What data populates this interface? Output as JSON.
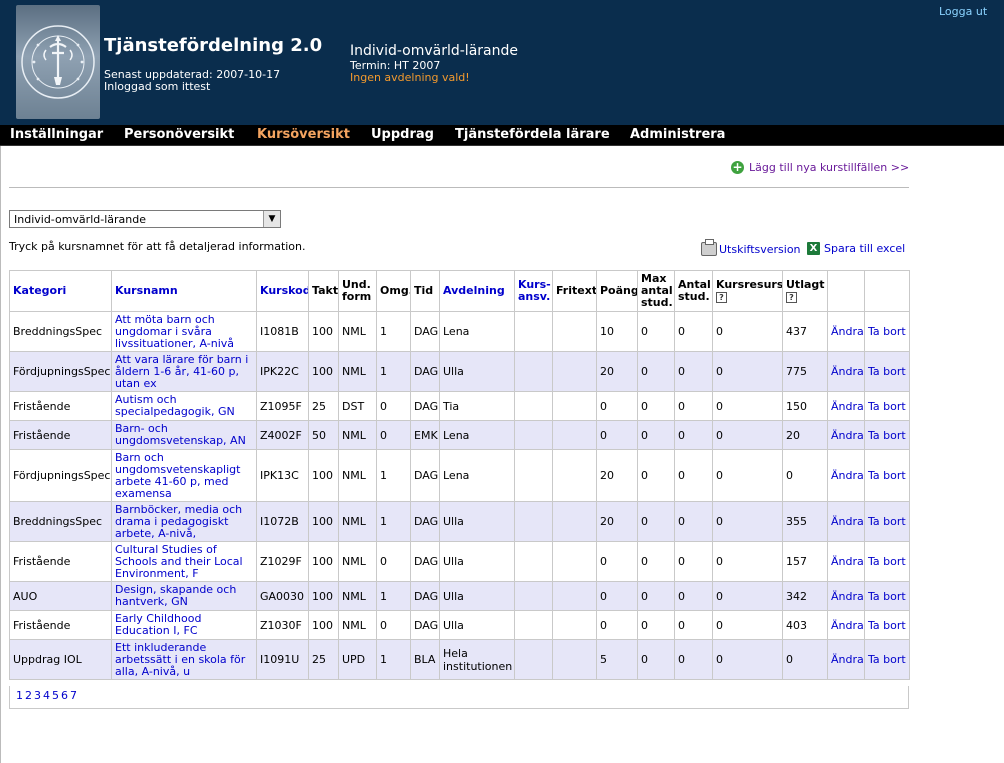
{
  "header": {
    "app_title": "Tjänstefördelning 2.0",
    "updated": "Senast uppdaterad: 2007-10-17",
    "logged_in": "Inloggad som ittest",
    "department": "Individ-omvärld-lärande",
    "term": "Termin: HT 2007",
    "warning": "Ingen avdelning vald!",
    "logout": "Logga ut",
    "logo_icon": "stockholm-university-seal-icon",
    "logo_lettering": "UNIVERSITET STOCKHOLMS"
  },
  "nav": {
    "items": [
      {
        "label": "Inställningar"
      },
      {
        "label": "Personöversikt"
      },
      {
        "label": "Kursöversikt"
      },
      {
        "label": "Uppdrag"
      },
      {
        "label": "Tjänstefördela lärare"
      },
      {
        "label": "Administrera"
      }
    ],
    "active": "Kursöversikt"
  },
  "content": {
    "add_link": "Lägg till nya kurstillfällen >>",
    "select_value": "Individ-omvärld-lärande",
    "hint": "Tryck på kursnamnet för att få detaljerad information.",
    "print_link": "Utskiftsversion",
    "excel_link": "Spara till excel"
  },
  "table": {
    "headers": {
      "kategori": "Kategori",
      "kursnamn": "Kursnamn",
      "kurskod": "Kurskod",
      "takt": "Takt",
      "undform_1": "Und.",
      "undform_2": "form",
      "omg": "Omg.",
      "tid": "Tid",
      "avdelning": "Avdelning",
      "kursansv_1": "Kurs-",
      "kursansv_2": "ansv.",
      "fritext": "Fritext",
      "poang": "Poäng",
      "max_1": "Max",
      "max_2": "antal",
      "max_3": "stud.",
      "antal_1": "Antal",
      "antal_2": "stud.",
      "kursresurs": "Kursresurs",
      "utlagt": "Utlagt",
      "help_glyph": "?"
    },
    "rows": [
      {
        "kategori": "BreddningsSpec",
        "kursnamn": "Att möta barn och ungdomar i svåra livssituationer, A-nivå",
        "kurskod": "I1081B",
        "takt": "100",
        "undform": "NML",
        "omg": "1",
        "tid": "DAG",
        "avdelning": "Lena",
        "kursansv": "",
        "fritext": "",
        "poang": "10",
        "max": "0",
        "antal": "0",
        "kursresurs": "0",
        "utlagt": "437",
        "edit": "Ändra",
        "delete": "Ta bort"
      },
      {
        "kategori": "FördjupningsSpec",
        "kursnamn": "Att vara lärare för barn i åldern 1-6 år, 41-60 p, utan ex",
        "kurskod": "IPK22C",
        "takt": "100",
        "undform": "NML",
        "omg": "1",
        "tid": "DAG",
        "avdelning": "Ulla",
        "kursansv": "",
        "fritext": "",
        "poang": "20",
        "max": "0",
        "antal": "0",
        "kursresurs": "0",
        "utlagt": "775",
        "edit": "Ändra",
        "delete": "Ta bort"
      },
      {
        "kategori": "Fristående",
        "kursnamn": "Autism och specialpedagogik, GN",
        "kurskod": "Z1095F",
        "takt": "25",
        "undform": "DST",
        "omg": "0",
        "tid": "DAG",
        "avdelning": "Tia",
        "kursansv": "",
        "fritext": "",
        "poang": "0",
        "max": "0",
        "antal": "0",
        "kursresurs": "0",
        "utlagt": "150",
        "edit": "Ändra",
        "delete": "Ta bort"
      },
      {
        "kategori": "Fristående",
        "kursnamn": "Barn- och ungdomsvetenskap, AN",
        "kurskod": "Z4002F",
        "takt": "50",
        "undform": "NML",
        "omg": "0",
        "tid": "EMK",
        "avdelning": "Lena",
        "kursansv": "",
        "fritext": "",
        "poang": "0",
        "max": "0",
        "antal": "0",
        "kursresurs": "0",
        "utlagt": "20",
        "edit": "Ändra",
        "delete": "Ta bort"
      },
      {
        "kategori": "FördjupningsSpec",
        "kursnamn": "Barn och ungdomsvetenskapligt arbete 41-60 p, med examensa",
        "kurskod": "IPK13C",
        "takt": "100",
        "undform": "NML",
        "omg": "1",
        "tid": "DAG",
        "avdelning": "Lena",
        "kursansv": "",
        "fritext": "",
        "poang": "20",
        "max": "0",
        "antal": "0",
        "kursresurs": "0",
        "utlagt": "0",
        "edit": "Ändra",
        "delete": "Ta bort"
      },
      {
        "kategori": "BreddningsSpec",
        "kursnamn": "Barnböcker, media och drama i pedagogiskt arbete, A-nivå,",
        "kurskod": "I1072B",
        "takt": "100",
        "undform": "NML",
        "omg": "1",
        "tid": "DAG",
        "avdelning": "Ulla",
        "kursansv": "",
        "fritext": "",
        "poang": "20",
        "max": "0",
        "antal": "0",
        "kursresurs": "0",
        "utlagt": "355",
        "edit": "Ändra",
        "delete": "Ta bort"
      },
      {
        "kategori": "Fristående",
        "kursnamn": "Cultural Studies of Schools and their Local Environment, F",
        "kurskod": "Z1029F",
        "takt": "100",
        "undform": "NML",
        "omg": "0",
        "tid": "DAG",
        "avdelning": "Ulla",
        "kursansv": "",
        "fritext": "",
        "poang": "0",
        "max": "0",
        "antal": "0",
        "kursresurs": "0",
        "utlagt": "157",
        "edit": "Ändra",
        "delete": "Ta bort"
      },
      {
        "kategori": "AUO",
        "kursnamn": "Design, skapande och hantverk, GN",
        "kurskod": "GA0030",
        "takt": "100",
        "undform": "NML",
        "omg": "1",
        "tid": "DAG",
        "avdelning": "Ulla",
        "kursansv": "",
        "fritext": "",
        "poang": "0",
        "max": "0",
        "antal": "0",
        "kursresurs": "0",
        "utlagt": "342",
        "edit": "Ändra",
        "delete": "Ta bort"
      },
      {
        "kategori": "Fristående",
        "kursnamn": "Early Childhood Education I, FC",
        "kurskod": "Z1030F",
        "takt": "100",
        "undform": "NML",
        "omg": "0",
        "tid": "DAG",
        "avdelning": "Ulla",
        "kursansv": "",
        "fritext": "",
        "poang": "0",
        "max": "0",
        "antal": "0",
        "kursresurs": "0",
        "utlagt": "403",
        "edit": "Ändra",
        "delete": "Ta bort"
      },
      {
        "kategori": "Uppdrag IOL",
        "kursnamn": "Ett inkluderande arbetssätt i en skola för alla, A-nivå, u",
        "kurskod": "I1091U",
        "takt": "25",
        "undform": "UPD",
        "omg": "1",
        "tid": "BLA",
        "avdelning": "Hela institutionen",
        "kursansv": "",
        "fritext": "",
        "poang": "5",
        "max": "0",
        "antal": "0",
        "kursresurs": "0",
        "utlagt": "0",
        "edit": "Ändra",
        "delete": "Ta bort"
      }
    ]
  },
  "pager": [
    "1",
    "2",
    "3",
    "4",
    "5",
    "6",
    "7"
  ]
}
